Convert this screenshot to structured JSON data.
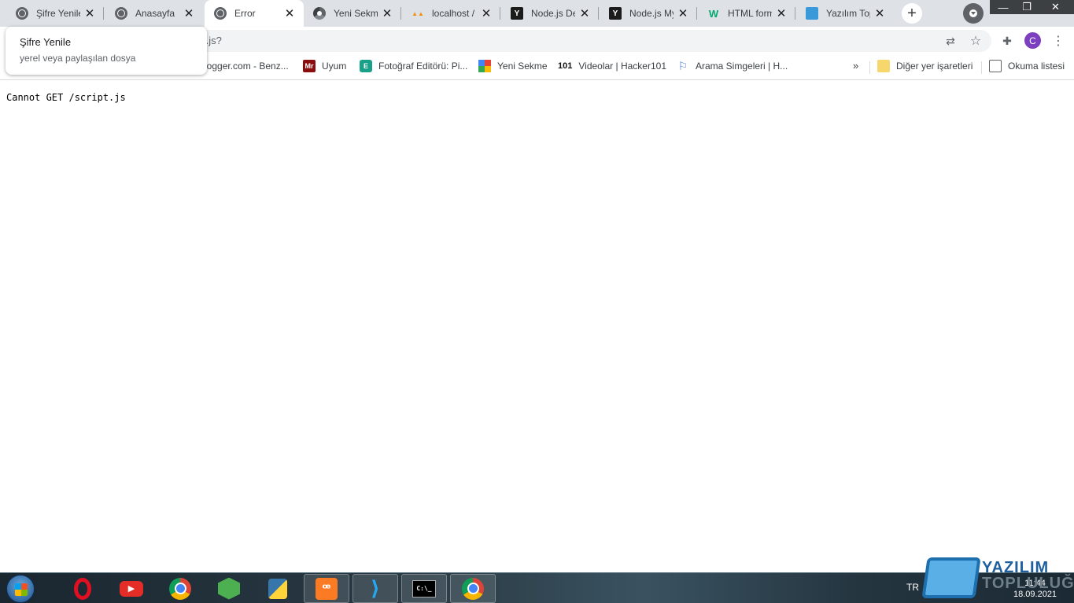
{
  "browser": {
    "tabs": [
      {
        "title": "Şifre Yenile",
        "favicon": "globe-icon",
        "active": false
      },
      {
        "title": "Anasayfa",
        "favicon": "globe-icon",
        "active": false
      },
      {
        "title": "Error",
        "favicon": "globe-icon",
        "active": true
      },
      {
        "title": "Yeni Sekme",
        "favicon": "chrome-icon",
        "active": false
      },
      {
        "title": "localhost /",
        "favicon": "phpmyadmin-icon",
        "active": false
      },
      {
        "title": "Node.js De",
        "favicon": "y-icon",
        "active": false
      },
      {
        "title": "Node.js My",
        "favicon": "y-icon",
        "active": false
      },
      {
        "title": "HTML form",
        "favicon": "w3-icon",
        "active": false
      },
      {
        "title": "Yazılım Top",
        "favicon": "site-icon",
        "active": false
      }
    ],
    "close_glyph": "✕",
    "new_tab_glyph": "+",
    "window_controls": {
      "minimize": "—",
      "maximize": "❐",
      "close": "✕"
    },
    "url_visible": "t.js?",
    "profile_initial": "C"
  },
  "tooltip": {
    "title": "Şifre Yenile",
    "subtitle": "yerel veya paylaşılan dosya"
  },
  "bookmarks": {
    "items": [
      {
        "label": "logger.com - Benz...",
        "icon": "none"
      },
      {
        "label": "Uyum",
        "icon": "uyum-icon",
        "glyph": "Mr"
      },
      {
        "label": "Fotoğraf Editörü: Pi...",
        "icon": "photo-editor-icon",
        "glyph": "E"
      },
      {
        "label": "Yeni Sekme",
        "icon": "apps-grid-icon"
      },
      {
        "label": "Videolar | Hacker101",
        "icon": "hacker101-icon",
        "glyph": "101"
      },
      {
        "label": "Arama Simgeleri | H...",
        "icon": "flag-icon",
        "glyph": "⚐"
      }
    ],
    "more_glyph": "»",
    "other_bookmarks": "Diğer yer işaretleri",
    "reading_list": "Okuma listesi"
  },
  "page": {
    "error_text": "Cannot GET /script.js"
  },
  "taskbar": {
    "apps": [
      "opera-icon",
      "youtube-icon",
      "chrome-icon",
      "nodejs-icon",
      "python-icon",
      "xampp-icon",
      "vscode-icon",
      "cmd-icon",
      "chrome-icon"
    ],
    "cmd_glyph": "C:\\_",
    "xampp_glyph": "ꟹ",
    "vscode_glyph": "⟩",
    "language": "TR",
    "time": "11:44",
    "date": "18.09.2021"
  },
  "watermark": {
    "line1": "YAZILIM",
    "line2": "TOPLULUĞU"
  }
}
